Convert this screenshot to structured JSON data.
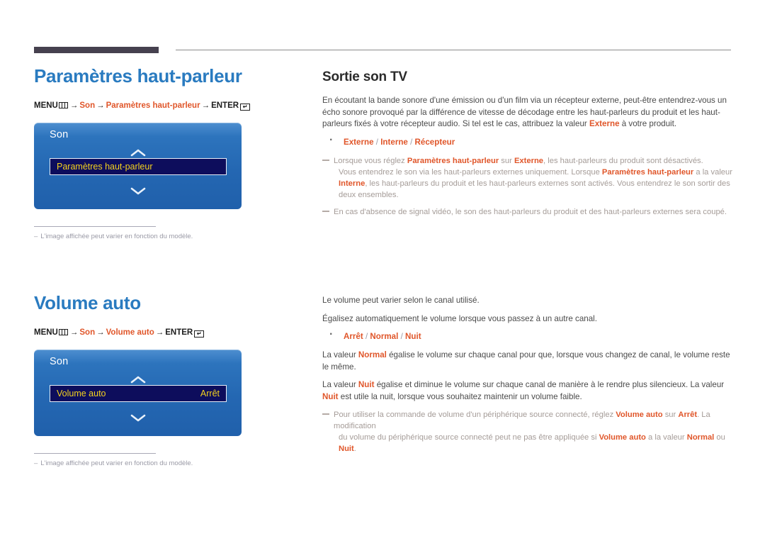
{
  "sections": [
    {
      "title": "Paramètres haut-parleur",
      "breadcrumb": {
        "menu_label": "MENU",
        "menu_icon": "menu-grid-icon",
        "arrow": "→",
        "path1": "Son",
        "path2": "Paramètres haut-parleur",
        "enter_label": "ENTER",
        "enter_icon": "enter-key-icon"
      },
      "osd": {
        "title": "Son",
        "up_icon": "chevron-up-icon",
        "down_icon": "chevron-down-icon",
        "row_label": "Paramètres haut-parleur",
        "row_value": ""
      },
      "caption": {
        "dash": "–",
        "text": "L'image affichée peut varier en fonction du modèle."
      },
      "sub_title": "Sortie son TV",
      "paragraphs": [
        {
          "runs": [
            {
              "t": "En écoutant la bande sonore d'une émission ou d'un film via un récepteur externe, peut-être entendrez-vous un écho sonore provoqué par la différence de vitesse de décodage entre les haut-parleurs du produit et les haut-parleurs fixés à votre récepteur audio. Si tel est le cas, attribuez la valeur ",
              "hl": false
            },
            {
              "t": "Externe",
              "hl": true
            },
            {
              "t": " à votre produit.",
              "hl": false
            }
          ]
        }
      ],
      "options": [
        {
          "value": "Externe"
        },
        {
          "value": "Interne"
        },
        {
          "value": "Récepteur"
        }
      ],
      "notes": [
        {
          "lines": [
            {
              "indent": false,
              "runs": [
                {
                  "t": "Lorsque vous réglez ",
                  "hl": false
                },
                {
                  "t": "Paramètres haut-parleur",
                  "hl": true
                },
                {
                  "t": " sur ",
                  "hl": false
                },
                {
                  "t": "Externe",
                  "hl": true
                },
                {
                  "t": ", les haut-parleurs du produit sont désactivés.",
                  "hl": false
                }
              ]
            },
            {
              "indent": true,
              "runs": [
                {
                  "t": "Vous entendrez le son via les haut-parleurs externes uniquement. Lorsque ",
                  "hl": false
                },
                {
                  "t": "Paramètres haut-parleur",
                  "hl": true
                },
                {
                  "t": " a la valeur ",
                  "hl": false
                },
                {
                  "t": "Interne",
                  "hl": true
                },
                {
                  "t": ", les haut-parleurs du produit et les haut-parleurs externes sont activés. Vous entendrez le son sortir des deux ensembles.",
                  "hl": false
                }
              ]
            }
          ]
        },
        {
          "lines": [
            {
              "indent": false,
              "runs": [
                {
                  "t": "En cas d'absence de signal vidéo, le son des haut-parleurs du produit et des haut-parleurs externes sera coupé.",
                  "hl": false
                }
              ]
            }
          ]
        }
      ]
    },
    {
      "title": "Volume auto",
      "breadcrumb": {
        "menu_label": "MENU",
        "menu_icon": "menu-grid-icon",
        "arrow": "→",
        "path1": "Son",
        "path2": "Volume auto",
        "enter_label": "ENTER",
        "enter_icon": "enter-key-icon"
      },
      "osd": {
        "title": "Son",
        "up_icon": "chevron-up-icon",
        "down_icon": "chevron-down-icon",
        "row_label": "Volume auto",
        "row_value": "Arrêt"
      },
      "caption": {
        "dash": "–",
        "text": "L'image affichée peut varier en fonction du modèle."
      },
      "sub_title": "",
      "paragraphs": [
        {
          "runs": [
            {
              "t": "Le volume peut varier selon le canal utilisé.",
              "hl": false
            }
          ]
        },
        {
          "runs": [
            {
              "t": "Égalisez automatiquement le volume lorsque vous passez à un autre canal.",
              "hl": false
            }
          ]
        }
      ],
      "options": [
        {
          "value": "Arrêt"
        },
        {
          "value": "Normal"
        },
        {
          "value": "Nuit"
        }
      ],
      "paragraphs_after": [
        {
          "runs": [
            {
              "t": "La valeur ",
              "hl": false
            },
            {
              "t": "Normal",
              "hl": true
            },
            {
              "t": " égalise le volume sur chaque canal pour que, lorsque vous changez de canal, le volume reste le même.",
              "hl": false
            }
          ]
        },
        {
          "runs": [
            {
              "t": "La valeur ",
              "hl": false
            },
            {
              "t": "Nuit",
              "hl": true
            },
            {
              "t": " égalise et diminue le volume sur chaque canal de manière à le rendre plus silencieux. La valeur ",
              "hl": false
            },
            {
              "t": "Nuit",
              "hl": true
            },
            {
              "t": " est utile la nuit, lorsque vous souhaitez maintenir un volume faible.",
              "hl": false
            }
          ]
        }
      ],
      "notes": [
        {
          "lines": [
            {
              "indent": false,
              "runs": [
                {
                  "t": "Pour utiliser la commande de volume d'un périphérique source connecté, réglez ",
                  "hl": false
                },
                {
                  "t": "Volume auto",
                  "hl": true
                },
                {
                  "t": " sur ",
                  "hl": false
                },
                {
                  "t": "Arrêt",
                  "hl": true
                },
                {
                  "t": ". La modification",
                  "hl": false
                }
              ]
            },
            {
              "indent": true,
              "runs": [
                {
                  "t": "du volume du périphérique source connecté peut ne pas être appliquée si ",
                  "hl": false
                },
                {
                  "t": "Volume auto",
                  "hl": true
                },
                {
                  "t": " a la valeur ",
                  "hl": false
                },
                {
                  "t": "Normal",
                  "hl": true
                },
                {
                  "t": " ou ",
                  "hl": false
                },
                {
                  "t": "Nuit",
                  "hl": true
                },
                {
                  "t": ".",
                  "hl": false
                }
              ]
            }
          ]
        }
      ]
    }
  ],
  "colors": {
    "heading_blue": "#2a7bc0",
    "accent_orange": "#e0562a",
    "osd_blue": "#2467b2",
    "osd_highlight": "#0d0d5c",
    "osd_yellow": "#f4d21e",
    "rule_dark": "#46414f"
  }
}
